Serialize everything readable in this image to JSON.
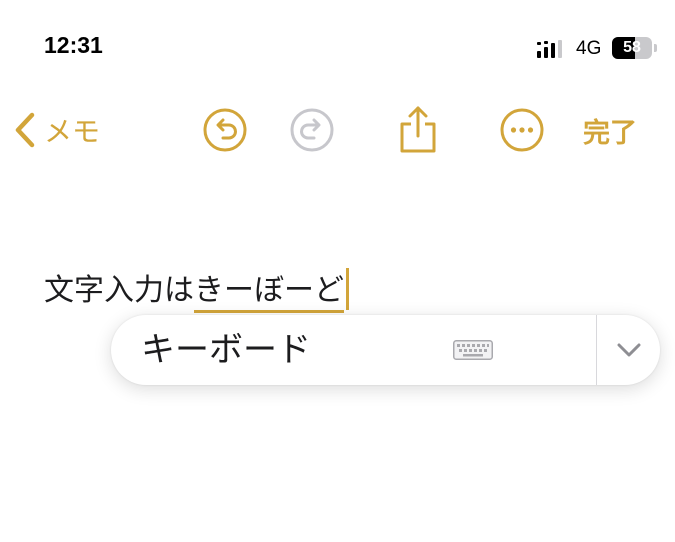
{
  "status_bar": {
    "time": "12:31",
    "network": "4G",
    "battery": {
      "text": "58",
      "level_percent": 58
    }
  },
  "toolbar": {
    "back_label": "メモ",
    "done_label": "完了"
  },
  "note": {
    "text_plain": "文字入力は",
    "text_marked": "きーぼーど"
  },
  "suggestion": {
    "candidate": "キーボード"
  },
  "colors": {
    "accent": "#d2a53a",
    "disabled": "#c7c7cc"
  },
  "icons": [
    "chevron-left-icon",
    "undo-icon",
    "redo-icon",
    "share-icon",
    "more-icon",
    "keyboard-icon",
    "chevron-down-icon"
  ]
}
